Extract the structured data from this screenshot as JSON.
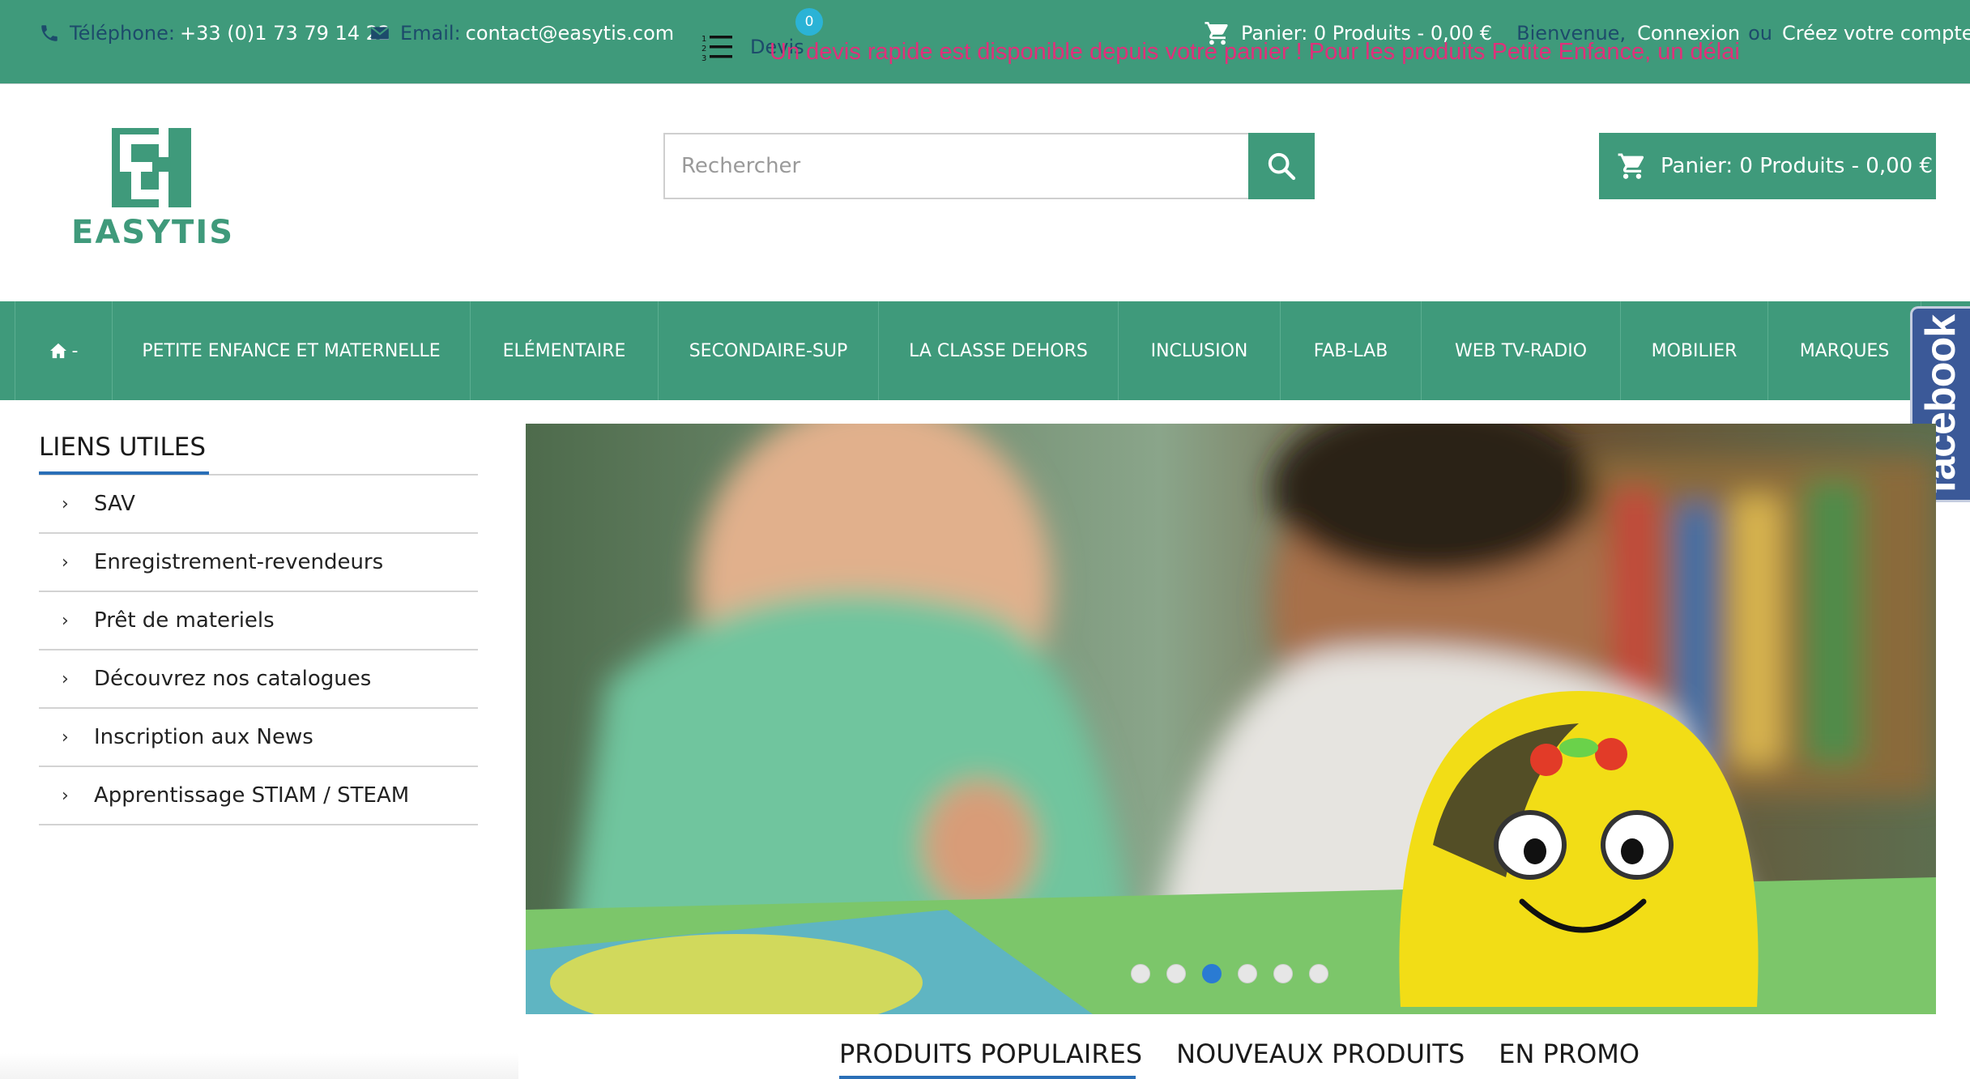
{
  "topbar": {
    "phone_label": "Téléphone:",
    "phone_value": "+33 (0)1 73 79 14 22",
    "email_label": "Email:",
    "email_value": "contact@easytis.com",
    "devis_label": "Devis",
    "devis_count": "0",
    "marquee_text": "Un devis rapide est disponible depuis votre panier ! Pour les produits Petite Enfance, un délai",
    "cart_text": "Panier: 0 Produits - 0,00 €",
    "welcome_label": "Bienvenue,",
    "login_link": "Connexion",
    "or_label": "ou",
    "register_link": "Créez votre compte"
  },
  "header": {
    "logo_text": "EASYTIS",
    "search_placeholder": "Rechercher",
    "cart_button": "Panier: 0 Produits - 0,00 €"
  },
  "nav": {
    "home_suffix": "-",
    "items": [
      "PETITE ENFANCE ET MATERNELLE",
      "ELÉMENTAIRE",
      "SECONDAIRE-SUP",
      "LA CLASSE DEHORS",
      "INCLUSION",
      "FAB-LAB",
      "WEB TV-RADIO",
      "MOBILIER",
      "MARQUES"
    ]
  },
  "facebook": {
    "label": "facebook"
  },
  "sidebar": {
    "title": "LIENS UTILES",
    "items": [
      "SAV",
      "Enregistrement-revendeurs",
      "Prêt de materiels",
      "Découvrez nos catalogues",
      "Inscription aux News",
      "Apprentissage STIAM / STEAM"
    ]
  },
  "slider": {
    "slide_count": 6,
    "active_index": 2
  },
  "product_tabs": [
    "PRODUITS POPULAIRES",
    "NOUVEAUX PRODUITS",
    "EN PROMO"
  ],
  "colors": {
    "brand_green": "#3f9a7b",
    "accent_blue": "#2a6fb7",
    "facebook_blue": "#3b5998",
    "marquee_pink": "#e0307a"
  }
}
